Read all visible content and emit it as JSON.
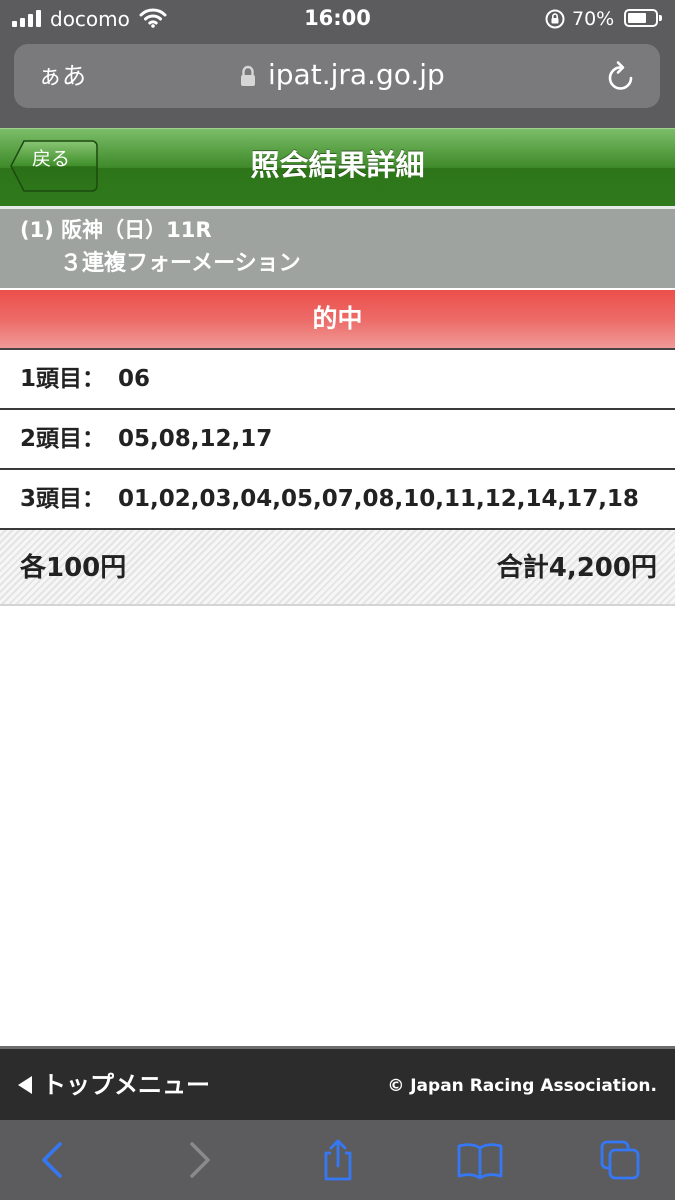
{
  "status_bar": {
    "carrier": "docomo",
    "time": "16:00",
    "battery_percent": "70%",
    "battery_level": 0.7
  },
  "browser": {
    "aa_label": "ぁあ",
    "url": "ipat.jra.go.jp"
  },
  "header": {
    "back_label": "戻る",
    "title": "照会結果詳細",
    "color": "#2f7a1c"
  },
  "race": {
    "line1": "(1) 阪神（日）11R",
    "line2": "３連複フォーメーション"
  },
  "result": {
    "label": "的中",
    "color": "#ec4f4b"
  },
  "selections": [
    {
      "label": "1頭目：",
      "value": "06"
    },
    {
      "label": "2頭目：",
      "value": "05,08,12,17"
    },
    {
      "label": "3頭目：",
      "value": "01,02,03,04,05,07,08,10,11,12,14,17,18"
    }
  ],
  "amount": {
    "per_bet": "各100円",
    "total": "合計4,200円"
  },
  "footer": {
    "top_menu": "トップメニュー",
    "copyright": "© Japan Racing Association."
  },
  "icons": {
    "status": [
      "signal-icon",
      "wifi-icon",
      "orientation-lock-icon",
      "battery-icon"
    ],
    "toolbar": [
      "back-arrow-icon",
      "forward-arrow-icon",
      "share-icon",
      "bookmarks-icon",
      "tabs-icon"
    ]
  },
  "colors": {
    "browser_chrome": "#5c5c5e",
    "toolbar_accent": "#3478f6",
    "footer": "#2c2c2c"
  }
}
